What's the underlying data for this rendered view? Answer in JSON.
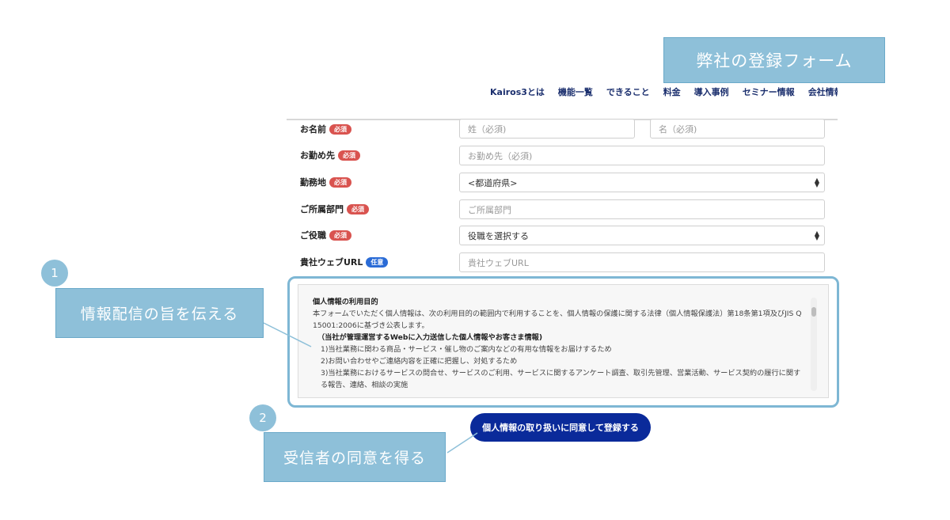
{
  "banner": {
    "title": "弊社の登録フォーム"
  },
  "nav": {
    "items": [
      "Kairos3とは",
      "機能一覧",
      "できること",
      "料金",
      "導入事例",
      "セミナー情報",
      "会社情報"
    ]
  },
  "form": {
    "rows": [
      {
        "label": "お名前",
        "badge": "必須",
        "placeholder1": "姓（必須)",
        "placeholder2": "名（必須)"
      },
      {
        "label": "お勤め先",
        "badge": "必須",
        "placeholder": "お勤め先（必須)"
      },
      {
        "label": "勤務地",
        "badge": "必須",
        "selected": "<都道府県>"
      },
      {
        "label": "ご所属部門",
        "badge": "必須",
        "placeholder": "ご所属部門"
      },
      {
        "label": "ご役職",
        "badge": "必須",
        "selected": "役職を選択する"
      },
      {
        "label": "貴社ウェブURL",
        "badge": "任意",
        "placeholder": "貴社ウェブURL"
      }
    ]
  },
  "privacy": {
    "heading": "個人情報の利用目的",
    "body": "本フォームでいただく個人情報は、次の利用目的の範囲内で利用することを、個人情報の保護に関する法律（個人情報保護法）第18条第1項及びJIS Q 15001:2006に基づき公表します。",
    "subheading": "（当社が管理運営するWebに入力送信した個人情報やお客さま情報)",
    "items": [
      "1)当社業務に関わる商品・サービス・催し物のご案内などの有用な情報をお届けするため",
      "2)お問い合わせやご連絡内容を正確に把握し、対処するため",
      "3)当社業務におけるサービスの問合せ、サービスのご利用、サービスに関するアンケート調査、取引先管理、営業活動、サービス契約の履行に関する報告、連絡、相談の実施"
    ]
  },
  "submit": {
    "label": "個人情報の取り扱いに同意して登録する"
  },
  "annotations": [
    {
      "number": "1",
      "text": "情報配信の旨を伝える"
    },
    {
      "number": "2",
      "text": "受信者の同意を得る"
    }
  ],
  "colors": {
    "accent": "#8ec0d9",
    "submit": "#0a2a9a",
    "required": "#d9534f",
    "optional": "#2a6bd6",
    "nav": "#1b2f6e"
  }
}
